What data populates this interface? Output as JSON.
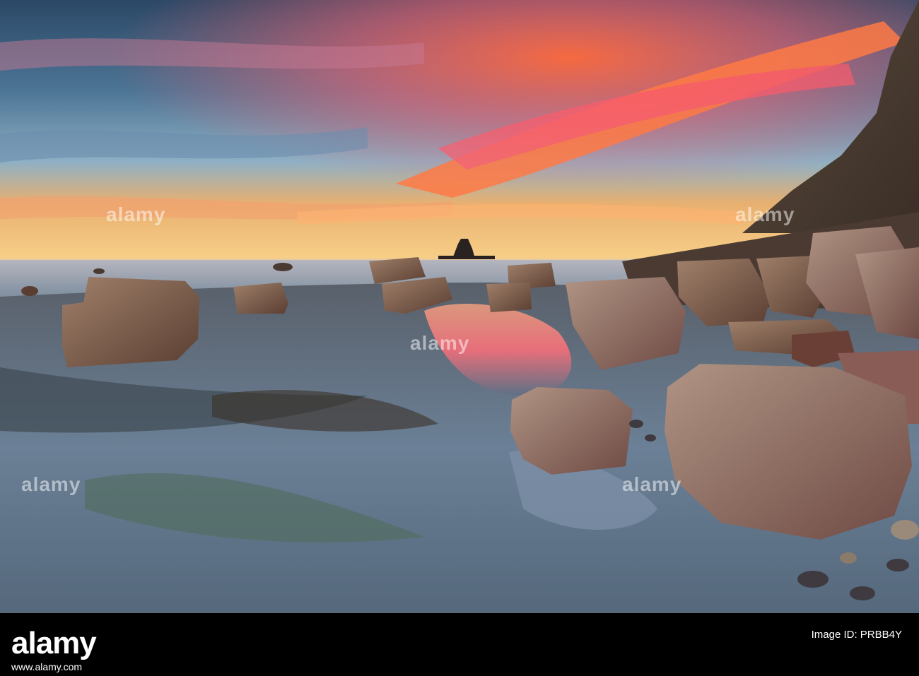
{
  "watermark": {
    "brand": "alamy",
    "slogan": "alamy"
  },
  "footer": {
    "logo": "alamy",
    "image_id_label": "Image ID: PRBB4Y",
    "image_id": "PRBB4Y",
    "url": "www.alamy.com"
  },
  "colors": {
    "sky_top": "#2f4f6e",
    "sunset_orange": "#ff7a45",
    "sunset_pink": "#ff5a6a",
    "horizon_gold": "#f7c56a",
    "sea": "#8fa1b2",
    "rock": "#7a5a48",
    "footer_bg": "#000000"
  }
}
